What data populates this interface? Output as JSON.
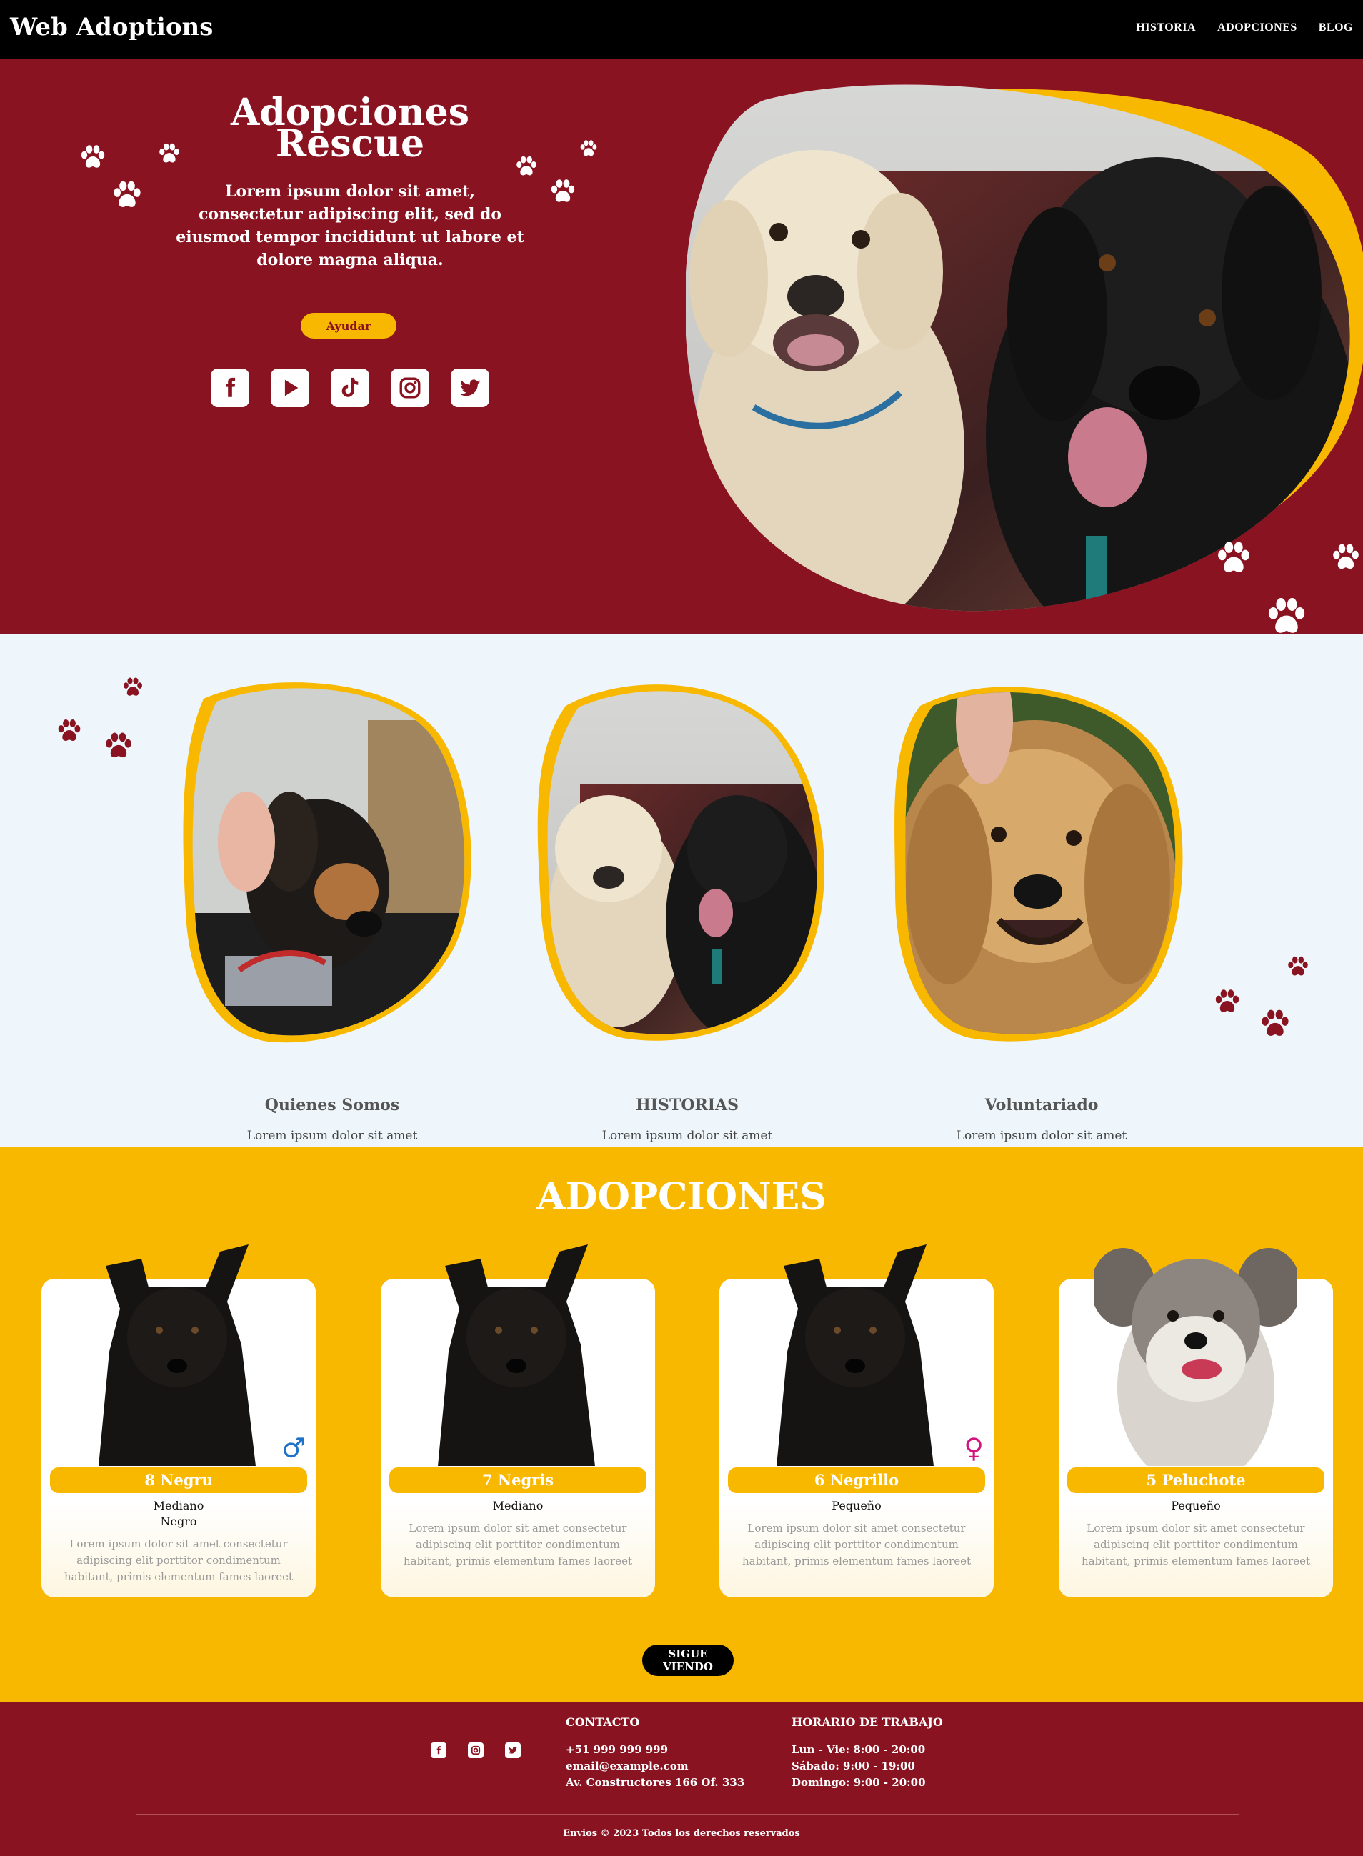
{
  "nav": {
    "logo": "Web Adoptions",
    "links": [
      "HISTORIA",
      "ADOPCIONES",
      "BLOG"
    ]
  },
  "hero": {
    "title_line1": "Adopciones",
    "title_line2": "Rescue",
    "description": "Lorem ipsum dolor sit amet, consectetur adipiscing elit, sed do eiusmod tempor incididunt ut labore et dolore magna aliqua.",
    "help_button": "Ayudar",
    "social_icons": [
      "facebook-icon",
      "youtube-icon",
      "tiktok-icon",
      "instagram-icon",
      "twitter-icon"
    ]
  },
  "features": [
    {
      "title": "Quienes Somos",
      "desc": "Lorem ipsum dolor sit amet"
    },
    {
      "title": "HISTORIAS",
      "desc": "Lorem ipsum dolor sit amet"
    },
    {
      "title": "Voluntariado",
      "desc": "Lorem ipsum dolor sit amet"
    }
  ],
  "adopciones": {
    "heading": "ADOPCIONES",
    "cards": [
      {
        "name": "8 Negru",
        "size": "Mediano",
        "color": "Negro",
        "sex": "♂",
        "text": "Lorem ipsum dolor sit amet consectetur adipiscing elit porttitor condimentum habitant, primis elementum fames laoreet"
      },
      {
        "name": "7 Negris",
        "size": "Mediano",
        "color": "",
        "sex": "",
        "text": "Lorem ipsum dolor sit amet consectetur adipiscing elit porttitor condimentum habitant, primis elementum fames laoreet"
      },
      {
        "name": "6 Negrillo",
        "size": "Pequeño",
        "color": "",
        "sex": "♀",
        "text": "Lorem ipsum dolor sit amet consectetur adipiscing elit porttitor condimentum habitant, primis elementum fames laoreet"
      },
      {
        "name": "5 Peluchote",
        "size": "Pequeño",
        "color": "",
        "sex": "",
        "text": "Lorem ipsum dolor sit amet consectetur adipiscing elit porttitor condimentum habitant, primis elementum fames laoreet"
      }
    ],
    "more_button": "SIGUE VIENDO"
  },
  "footer": {
    "contact_heading": "CONTACTO",
    "phone": "+51 999 999 999",
    "email": "email@example.com",
    "address": "Av. Constructores 166 Of. 333",
    "hours_heading": "HORARIO DE TRABAJO",
    "hours": [
      "Lun - Vie: 8:00 - 20:00",
      "Sábado: 9:00 - 19:00",
      "Domingo: 9:00 - 20:00"
    ],
    "copyright": "Envios © 2023 Todos los derechos reservados",
    "social_icons": [
      "facebook-icon",
      "instagram-icon",
      "twitter-icon"
    ]
  },
  "colors": {
    "brand_red": "#8a1321",
    "brand_yellow": "#f9b800",
    "light_bg": "#eef6fb",
    "male_blue": "#1e73c8",
    "female_pink": "#d3147f"
  }
}
